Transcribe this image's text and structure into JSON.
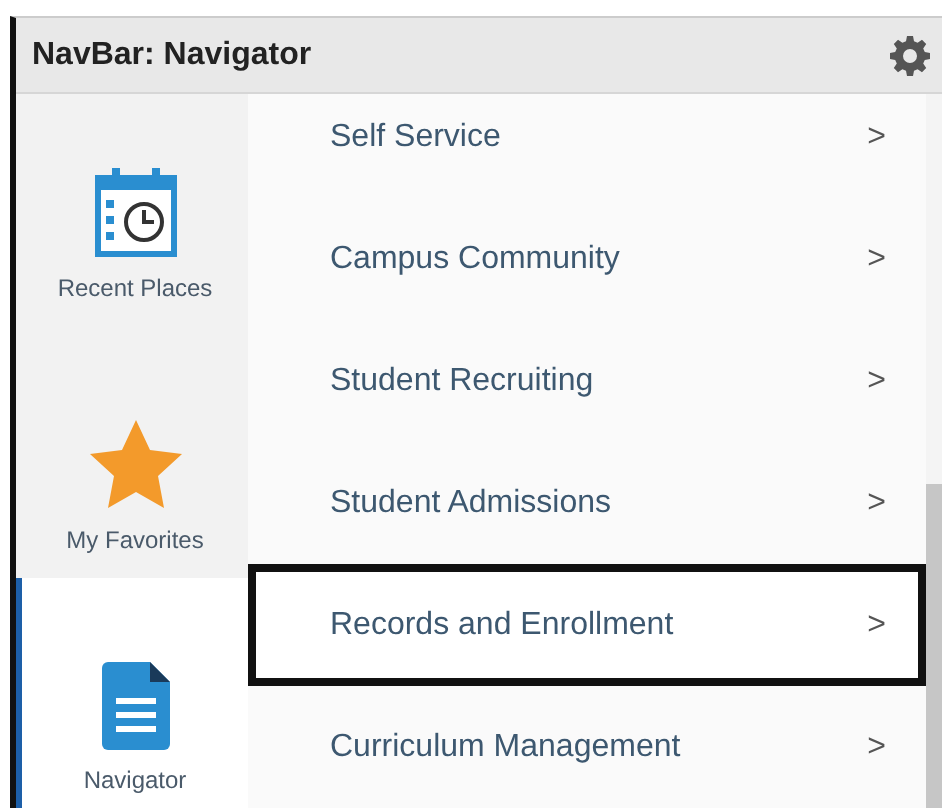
{
  "header": {
    "title": "NavBar: Navigator"
  },
  "sidebar": {
    "items": [
      {
        "label": "Recent Places",
        "kind": "recent",
        "selected": false
      },
      {
        "label": "My Favorites",
        "kind": "favorites",
        "selected": false
      },
      {
        "label": "Navigator",
        "kind": "navigator",
        "selected": true
      }
    ]
  },
  "menu": {
    "items": [
      {
        "label": "Self Service",
        "chevron": ">",
        "highlighted": false
      },
      {
        "label": "Campus Community",
        "chevron": ">",
        "highlighted": false
      },
      {
        "label": "Student Recruiting",
        "chevron": ">",
        "highlighted": false
      },
      {
        "label": "Student Admissions",
        "chevron": ">",
        "highlighted": false
      },
      {
        "label": "Records and Enrollment",
        "chevron": ">",
        "highlighted": true
      },
      {
        "label": "Curriculum Management",
        "chevron": ">",
        "highlighted": false
      }
    ]
  }
}
